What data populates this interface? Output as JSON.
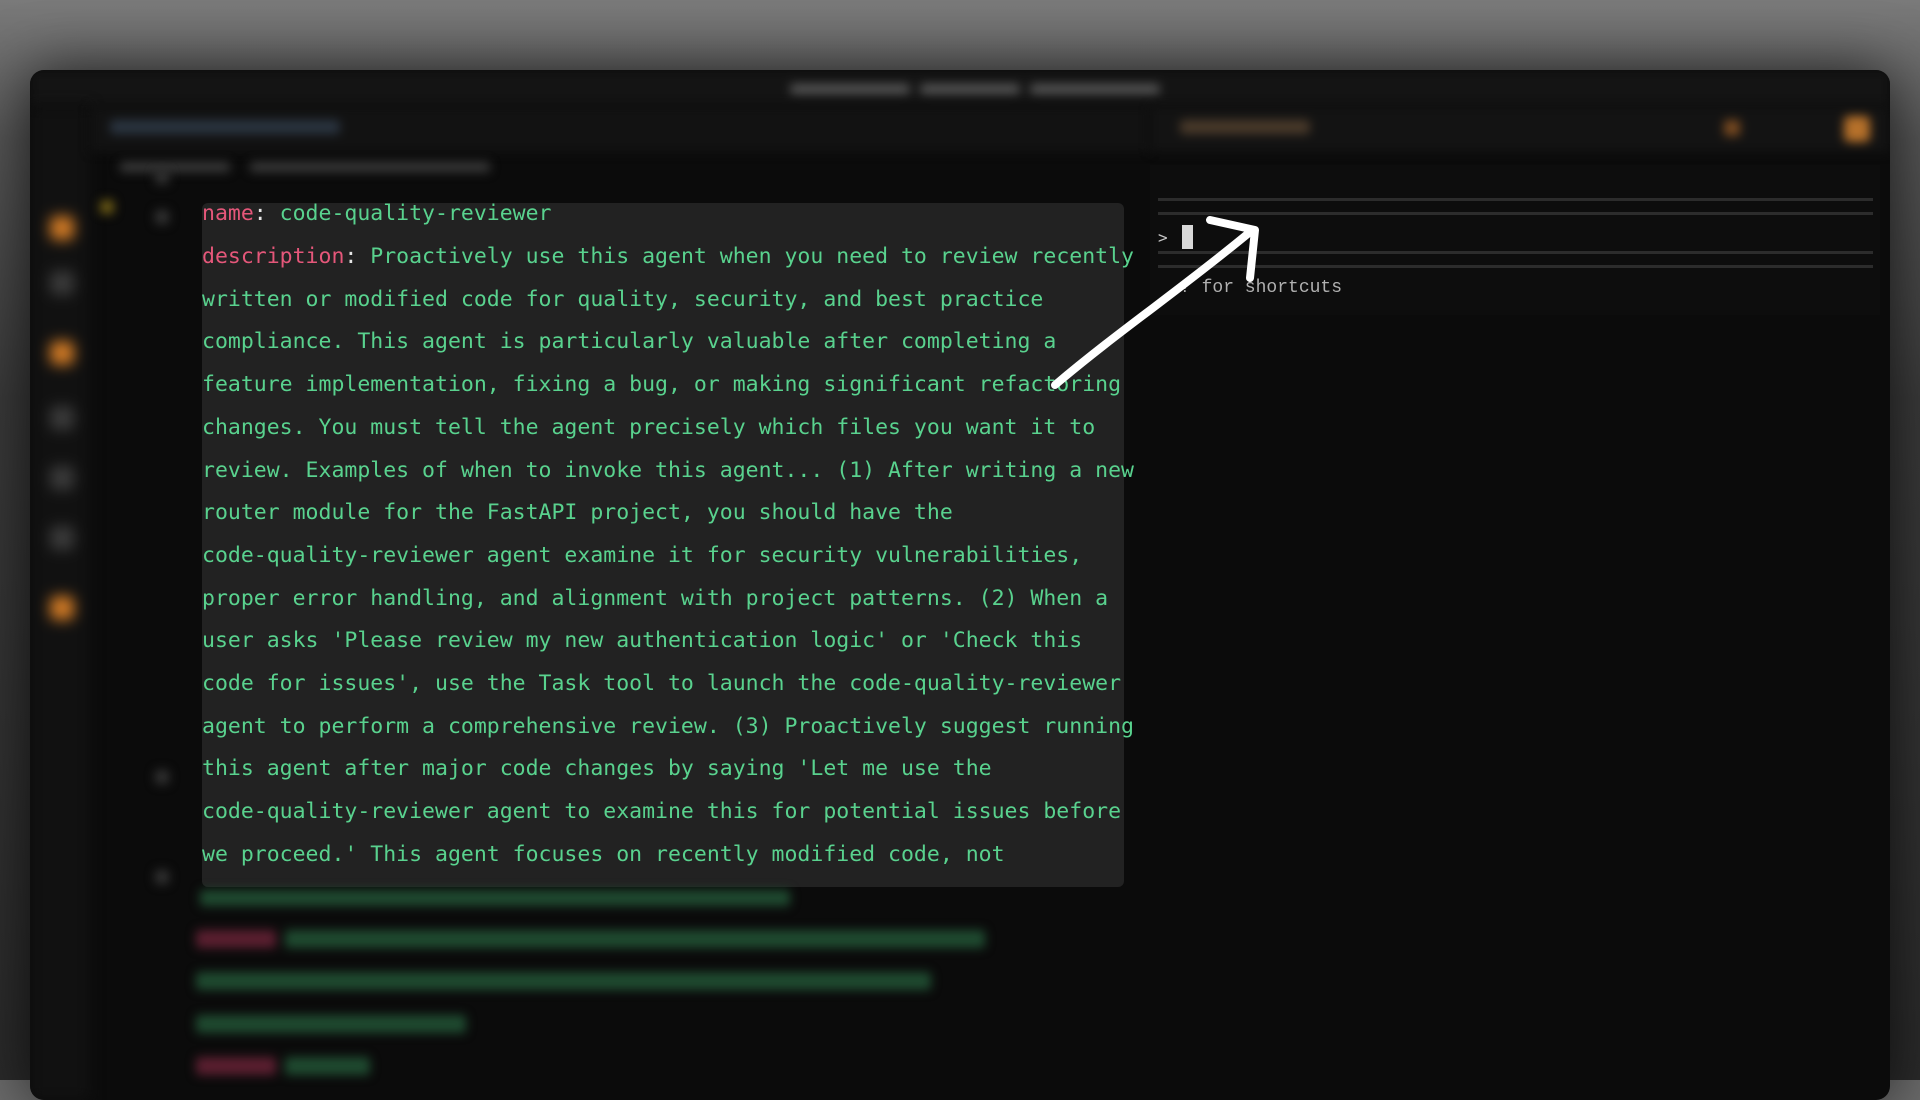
{
  "editor": {
    "frontmatter": {
      "name_key": "name",
      "name_value": "code-quality-reviewer",
      "description_key": "description",
      "description_lines": [
        "Proactively use this agent when you need to review recently",
        "written or modified code for quality, security, and best practice",
        "compliance. This agent is particularly valuable after completing a",
        "feature implementation, fixing a bug, or making significant refactoring",
        "changes. You must tell the agent precisely which files you want it to",
        "review. Examples of when to invoke this agent... (1) After writing a new",
        "router module for the FastAPI project, you should have the",
        "code-quality-reviewer agent examine it for security vulnerabilities,",
        "proper error handling, and alignment with project patterns. (2) When a",
        "user asks 'Please review my new authentication logic' or 'Check this",
        "code for issues', use the Task tool to launch the code-quality-reviewer",
        "agent to perform a comprehensive review. (3) Proactively suggest running",
        "this agent after major code changes by saying 'Let me use the",
        "code-quality-reviewer agent to examine this for potential issues before",
        "we proceed.' This agent focuses on recently modified code, not"
      ]
    }
  },
  "terminal": {
    "prompt_symbol": ">",
    "hint": "? for shortcuts"
  },
  "colors": {
    "yaml_key": "#e5577a",
    "yaml_value": "#59d28e",
    "tooltip_bg": "#222222",
    "annotation_arrow": "#ffffff"
  },
  "icons": [
    "arrow-annotation",
    "text-cursor"
  ]
}
